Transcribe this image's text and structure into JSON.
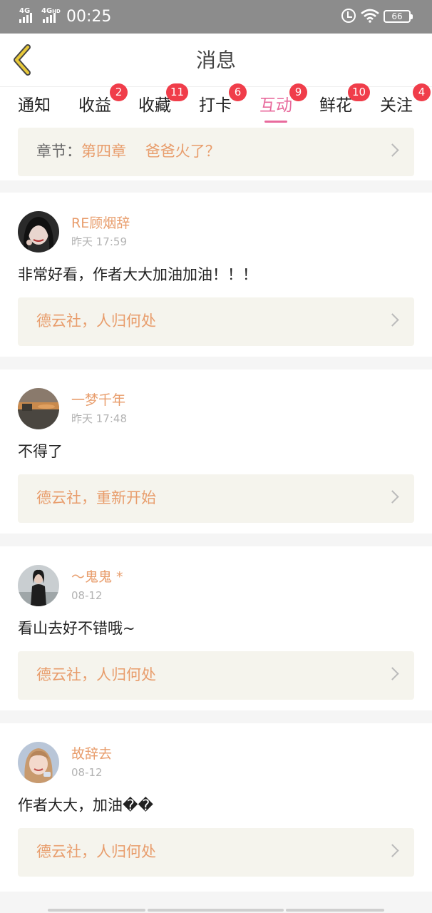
{
  "status_bar": {
    "net1": "4G",
    "net2": "4G",
    "net2_suffix": "HD",
    "time": "00:25",
    "battery": "66",
    "icons": [
      "signal-icon",
      "alarm-icon",
      "wifi-icon",
      "battery-icon"
    ]
  },
  "header": {
    "title": "消息",
    "back_icon": "chevron-left-icon",
    "accent_color": "#e8c93a"
  },
  "tabs": [
    {
      "label": "通知",
      "badge": ""
    },
    {
      "label": "收益",
      "badge": "2"
    },
    {
      "label": "收藏",
      "badge": "11"
    },
    {
      "label": "打卡",
      "badge": "6"
    },
    {
      "label": "互动",
      "badge": "9",
      "active": true
    },
    {
      "label": "鲜花",
      "badge": "10"
    },
    {
      "label": "关注",
      "badge": "4"
    }
  ],
  "colors": {
    "active_tab": "#e86a9c",
    "badge": "#f03d4a",
    "username": "#e89d6c",
    "link_text": "#e89d6c",
    "link_bg": "#f5f4ed"
  },
  "top_link": {
    "prefix": "章节：",
    "chapter": "第四章",
    "title": "爸爸火了？"
  },
  "messages": [
    {
      "username": "RE顾烟辞",
      "time": "昨天 17:59",
      "comment": "非常好看，作者大大加油加油！！！",
      "link": "德云社，人归何处"
    },
    {
      "username": "一梦千年",
      "time": "昨天 17:48",
      "comment": "不得了",
      "link": "德云社，重新开始"
    },
    {
      "username": "～鬼鬼 *",
      "time": "08-12",
      "comment": "看山去好不错哦~",
      "link": "德云社，人归何处"
    },
    {
      "username": "故辞去",
      "time": "08-12",
      "comment": "作者大大，加油��",
      "link": "德云社，人归何处"
    }
  ]
}
